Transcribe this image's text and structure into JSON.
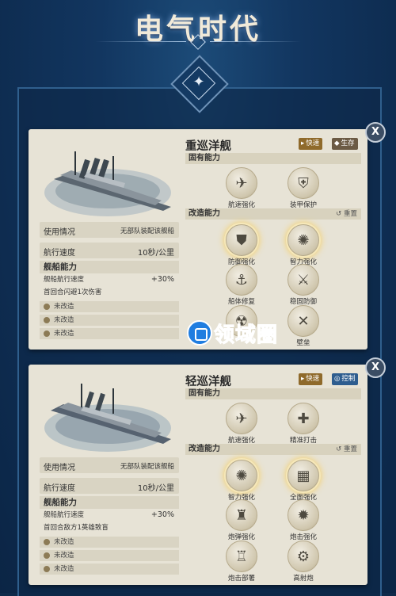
{
  "page": {
    "title": "电气时代"
  },
  "cards": [
    {
      "name": "重巡洋舰",
      "tags": [
        {
          "label": "快速",
          "style": "speed"
        },
        {
          "label": "生存",
          "style": "alt"
        }
      ],
      "usage_label": "使用情况",
      "usage_value": "无部队装配该舰船",
      "speed_label": "航行速度",
      "speed_value": "10秒/公里",
      "ability_header": "舰船能力",
      "ability_lines": [
        {
          "text": "舰船航行速度",
          "value": "+30%"
        },
        {
          "text": "首回合闪避1次伤害",
          "value": ""
        }
      ],
      "slots": [
        "未改造",
        "未改造",
        "未改造"
      ],
      "innate_header": "固有能力",
      "innate": [
        {
          "name": "航速强化",
          "icon": "✈"
        },
        {
          "name": "装甲保护",
          "icon": "⛨"
        }
      ],
      "mod_header": "改造能力",
      "reset_label": "重置",
      "mods": [
        {
          "name": "防御强化",
          "icon": "⛊",
          "glow": true
        },
        {
          "name": "智力强化",
          "icon": "✺",
          "glow": true
        },
        {
          "name": "船体修复",
          "icon": "⚓",
          "glow": false
        },
        {
          "name": "稳固防御",
          "icon": "⚔",
          "glow": false
        },
        {
          "name": "",
          "icon": "☢",
          "glow": false
        },
        {
          "name": "壁垒",
          "icon": "✕",
          "glow": false
        }
      ]
    },
    {
      "name": "轻巡洋舰",
      "tags": [
        {
          "label": "快速",
          "style": "speed"
        },
        {
          "label": "控制",
          "style": "ctrl"
        }
      ],
      "usage_label": "使用情况",
      "usage_value": "无部队装配该舰船",
      "speed_label": "航行速度",
      "speed_value": "10秒/公里",
      "ability_header": "舰船能力",
      "ability_lines": [
        {
          "text": "舰船航行速度",
          "value": "+30%"
        },
        {
          "text": "首回合敌方1英雄致盲",
          "value": ""
        }
      ],
      "slots": [
        "未改造",
        "未改造",
        "未改造"
      ],
      "innate_header": "固有能力",
      "innate": [
        {
          "name": "航速强化",
          "icon": "✈"
        },
        {
          "name": "精准打击",
          "icon": "✚"
        }
      ],
      "mod_header": "改造能力",
      "reset_label": "重置",
      "mods": [
        {
          "name": "智力强化",
          "icon": "✺",
          "glow": true
        },
        {
          "name": "全面强化",
          "icon": "▦",
          "glow": true
        },
        {
          "name": "炮弹强化",
          "icon": "♜",
          "glow": false
        },
        {
          "name": "炮击强化",
          "icon": "✹",
          "glow": false
        },
        {
          "name": "炮击部署",
          "icon": "♖",
          "glow": false
        },
        {
          "name": "高射炮",
          "icon": "⚙",
          "glow": false
        }
      ]
    }
  ],
  "watermark": {
    "text": "领域圈"
  },
  "close_label": "X"
}
